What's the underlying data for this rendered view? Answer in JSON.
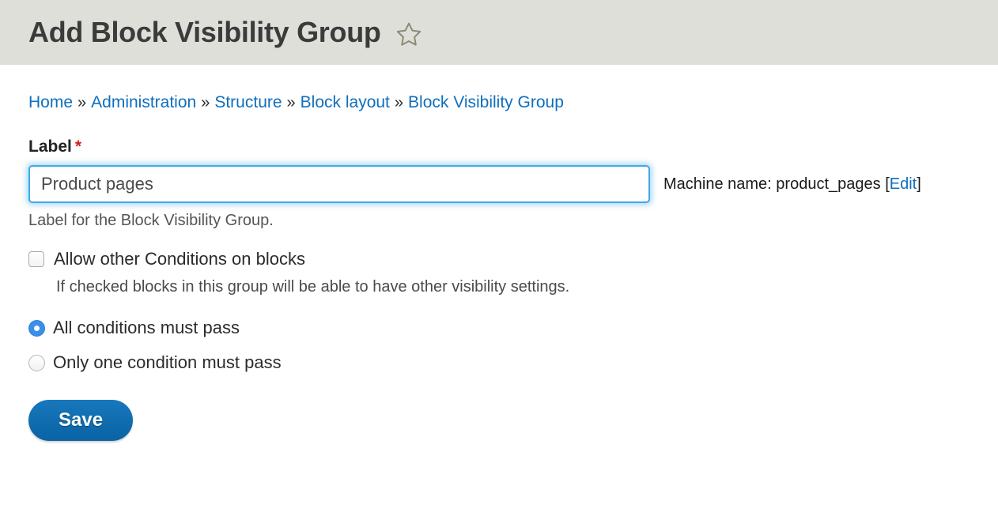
{
  "header": {
    "title": "Add Block Visibility Group",
    "star_icon": "star-outline-icon"
  },
  "breadcrumb": {
    "separator": "»",
    "items": [
      {
        "label": "Home"
      },
      {
        "label": "Administration"
      },
      {
        "label": "Structure"
      },
      {
        "label": "Block layout"
      },
      {
        "label": "Block Visibility Group"
      }
    ]
  },
  "form": {
    "label_field": {
      "label": "Label",
      "required_mark": "*",
      "value": "Product pages",
      "placeholder": "",
      "description": "Label for the Block Visibility Group.",
      "machine_name_prefix": "Machine name: ",
      "machine_name_value": "product_pages",
      "bracket_open": "[",
      "edit_link": "Edit",
      "bracket_close": "]"
    },
    "allow_other_conditions": {
      "label": "Allow other Conditions on blocks",
      "checked": false,
      "description": "If checked blocks in this group will be able to have other visibility settings."
    },
    "condition_logic": {
      "options": [
        {
          "label": "All conditions must pass",
          "selected": true
        },
        {
          "label": "Only one condition must pass",
          "selected": false
        }
      ]
    },
    "save_label": "Save"
  },
  "colors": {
    "header_bg": "#dfdfd9",
    "link": "#0f6fbd",
    "required": "#d4201a",
    "focus_border": "#41a8e8",
    "radio_selected": "#3b8fe8",
    "button_bg": "#0f6cae"
  }
}
